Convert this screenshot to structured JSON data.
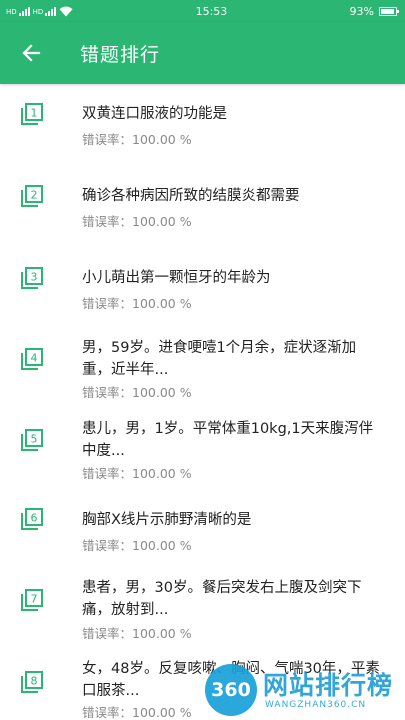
{
  "status_bar": {
    "time": "15:53",
    "battery": "93%",
    "battery_level": 0.93,
    "network": "HD"
  },
  "header": {
    "title": "错题排行",
    "back_icon": "arrow-left-icon",
    "color": "#2bb673"
  },
  "items": [
    {
      "num": "1",
      "question": "双黄连口服液的功能是",
      "rate": "错误率：100.00 %"
    },
    {
      "num": "2",
      "question": "确诊各种病因所致的结膜炎都需要",
      "rate": "错误率：100.00 %"
    },
    {
      "num": "3",
      "question": "小儿萌出第一颗恒牙的年龄为",
      "rate": "错误率：100.00 %"
    },
    {
      "num": "4",
      "question": "男，59岁。进食哽噎1个月余，症状逐渐加重，近半年...",
      "rate": "错误率：100.00 %"
    },
    {
      "num": "5",
      "question": "患儿，男，1岁。平常体重10kg,1天来腹泻伴中度...",
      "rate": "错误率：100.00 %"
    },
    {
      "num": "6",
      "question": "胸部X线片示肺野清晰的是",
      "rate": "错误率：100.00 %"
    },
    {
      "num": "7",
      "question": "患者，男，30岁。餐后突发右上腹及剑突下痛，放射到...",
      "rate": "错误率：100.00 %"
    },
    {
      "num": "8",
      "question": "女，48岁。反复咳嗽、胸闷、气喘30年，平素口服茶...",
      "rate": "错误率：100.00 %"
    }
  ],
  "watermark": {
    "badge": "360",
    "main": "网站排行榜",
    "sub": "WANGZHAN360.CN"
  }
}
